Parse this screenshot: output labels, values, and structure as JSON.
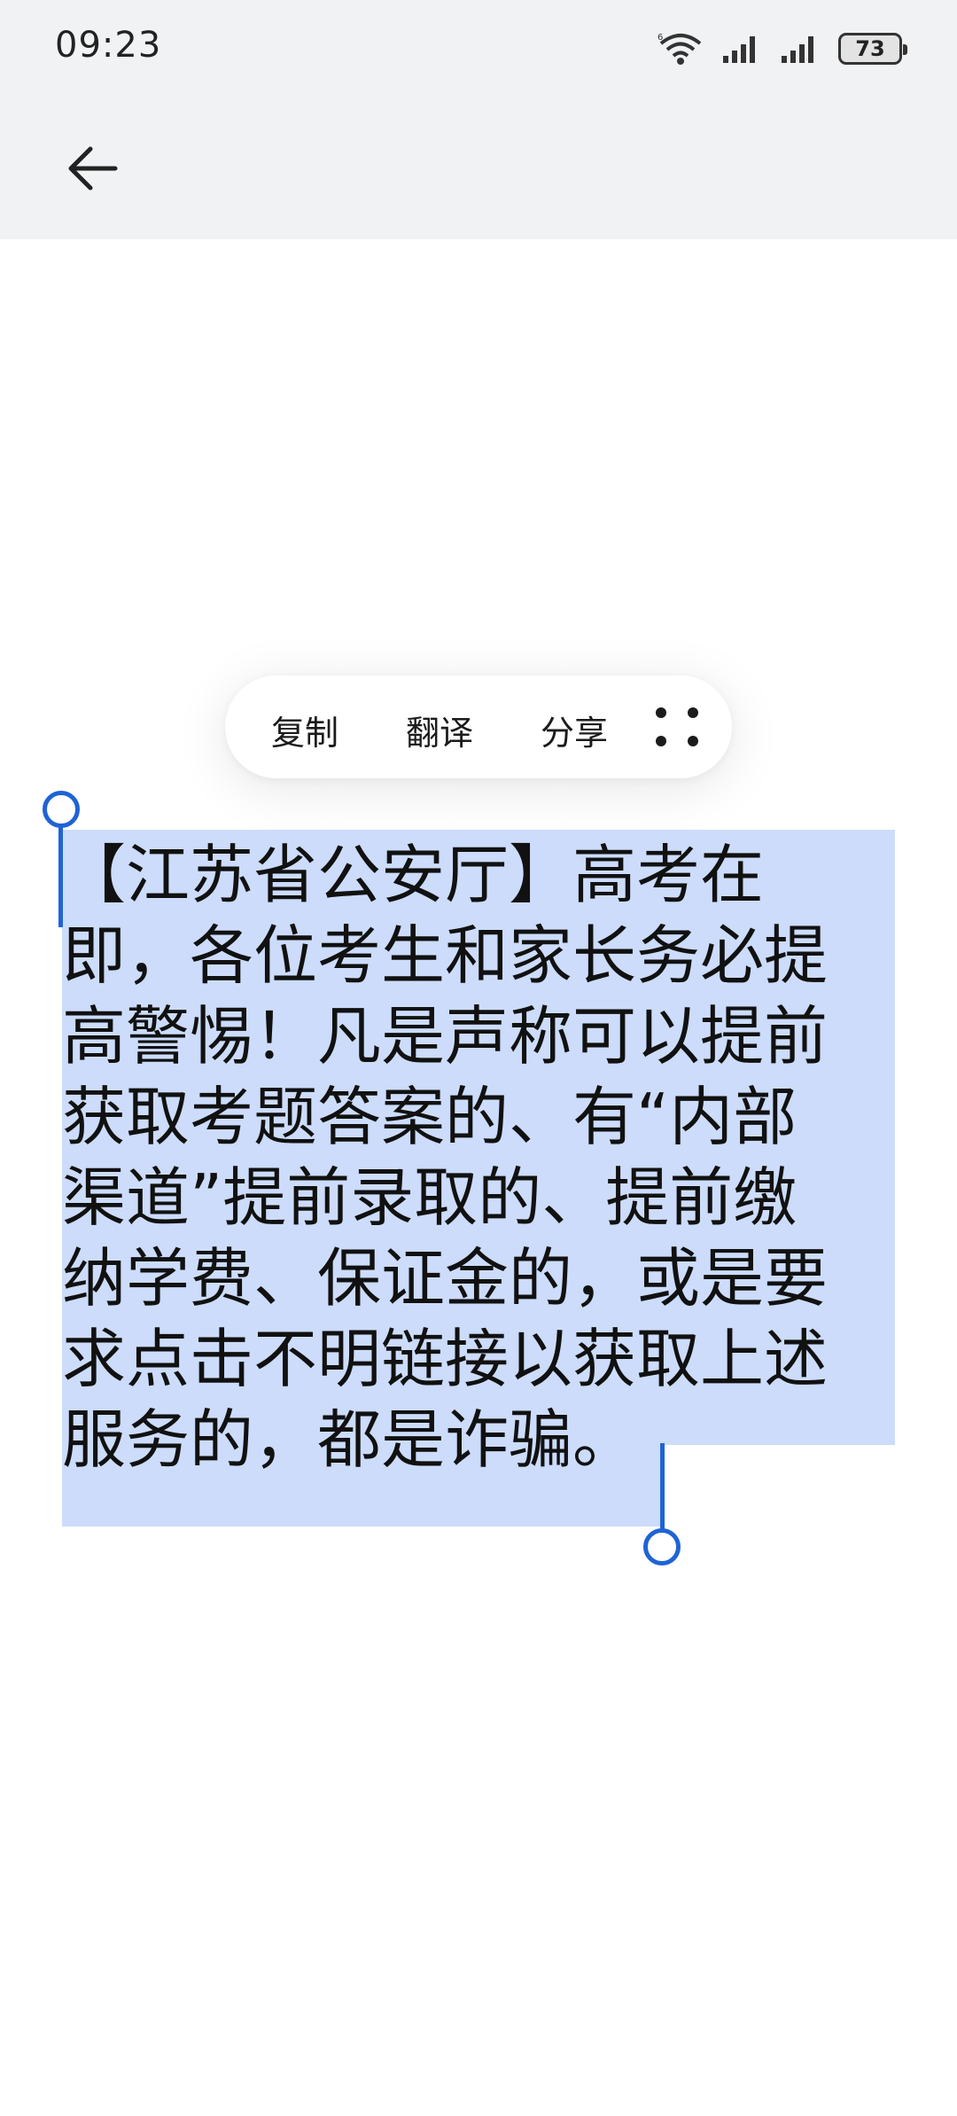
{
  "status_bar": {
    "time": "09:23",
    "battery": "73",
    "icons": [
      "wifi-icon",
      "cellular-signal-icon",
      "cellular-signal-icon",
      "battery-icon"
    ]
  },
  "app_bar": {
    "back_icon": "arrow-left-icon"
  },
  "toolbar": {
    "copy": "复制",
    "translate": "翻译",
    "share": "分享",
    "more_icon": "more-dots-icon"
  },
  "message": {
    "lines": [
      "【江苏省公安厅】高考在",
      "即，各位考生和家长务必提",
      "高警惕！凡是声称可以提前",
      "获取考题答案的、有“内部",
      "渠道”提前录取的、提前缴",
      "纳学费、保证金的，或是要",
      "求点击不明链接以获取上述",
      "服务的，都是诈骗。"
    ]
  },
  "colors": {
    "selection": "#ccdcfa",
    "handle": "#1f63d6",
    "header_bg": "#f1f2f4"
  }
}
